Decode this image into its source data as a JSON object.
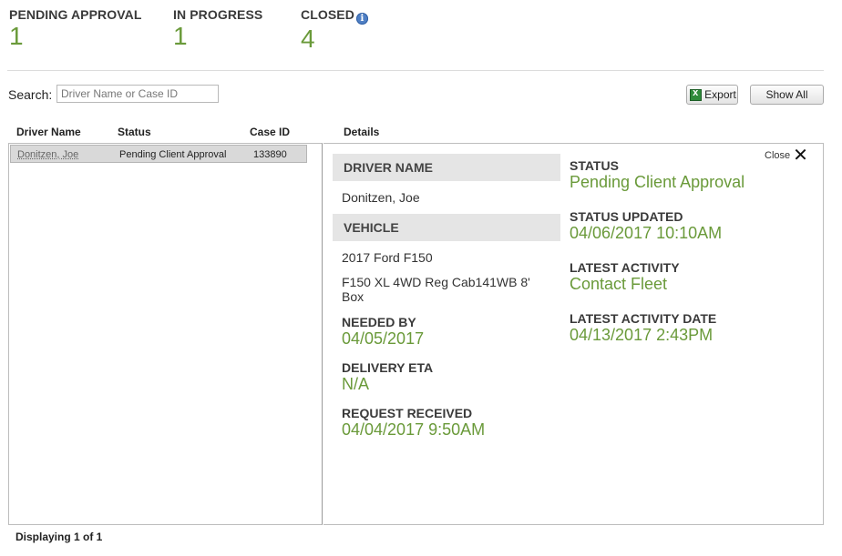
{
  "summary": {
    "pending_label": "PENDING APPROVAL",
    "pending_count": "1",
    "inprogress_label": "IN PROGRESS",
    "inprogress_count": "1",
    "closed_label": "CLOSED",
    "closed_count": "4",
    "info_glyph": "i"
  },
  "search": {
    "label": "Search:",
    "placeholder": "Driver Name or Case ID",
    "value": ""
  },
  "toolbar": {
    "export_label": "Export",
    "show_all_label": "Show All"
  },
  "table": {
    "columns": [
      "Driver Name",
      "Status",
      "Case ID"
    ],
    "details_header": "Details",
    "rows": [
      {
        "driver": "Donitzen, Joe",
        "status": "Pending Client Approval",
        "case_id": "133890"
      }
    ]
  },
  "details": {
    "close_label": "Close",
    "close_glyph": "✕",
    "driver_name_header": "DRIVER NAME",
    "driver_name": "Donitzen, Joe",
    "vehicle_header": "VEHICLE",
    "vehicle_line1": "2017 Ford F150",
    "vehicle_line2": "F150 XL 4WD Reg Cab141WB 8' Box",
    "needed_by_label": "NEEDED BY",
    "needed_by": "04/05/2017",
    "delivery_eta_label": "DELIVERY ETA",
    "delivery_eta": "N/A",
    "request_received_label": "REQUEST RECEIVED",
    "request_received": "04/04/2017 9:50AM",
    "status_label": "STATUS",
    "status": "Pending Client Approval",
    "status_updated_label": "STATUS UPDATED",
    "status_updated": "04/06/2017 10:10AM",
    "latest_activity_label": "LATEST ACTIVITY",
    "latest_activity": "Contact Fleet",
    "latest_activity_date_label": "LATEST ACTIVITY DATE",
    "latest_activity_date": "04/13/2017 2:43PM"
  },
  "footer": {
    "text": "Displaying 1 of 1"
  },
  "colors": {
    "accent_green": "#6a9a3a",
    "info_blue": "#4f7fc4"
  }
}
